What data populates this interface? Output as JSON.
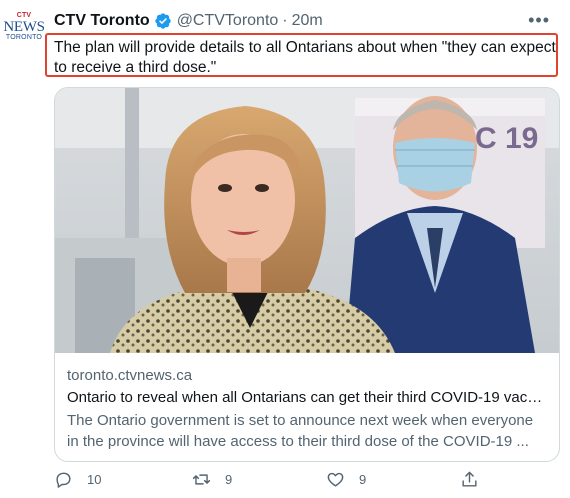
{
  "account": {
    "avatar_top": "CTV",
    "avatar_middle": "NEWS",
    "avatar_bottom": "TORONTO",
    "display_name": "CTV Toronto",
    "handle": "@CTVToronto",
    "separator": "·",
    "timestamp": "20m",
    "more_glyph": "•••"
  },
  "tweet": {
    "text": "The plan will provide details to all Ontarians about when \"they can expect to receive a third dose.\""
  },
  "card": {
    "image_icon": "photo-woman-speaking-man-with-mask",
    "domain": "toronto.ctvnews.ca",
    "title": "Ontario to reveal when all Ontarians can get their third COVID-19 vacc...",
    "description": "The Ontario government is set to announce next week when everyone in the province will have access to their third dose of the COVID-19 ..."
  },
  "actions": {
    "reply_count": "10",
    "retweet_count": "9",
    "like_count": "9",
    "share_icon": "share-icon"
  },
  "colors": {
    "highlight_border": "#e0432f",
    "verified_badge": "#1d9bf0",
    "secondary_text": "#536471"
  }
}
